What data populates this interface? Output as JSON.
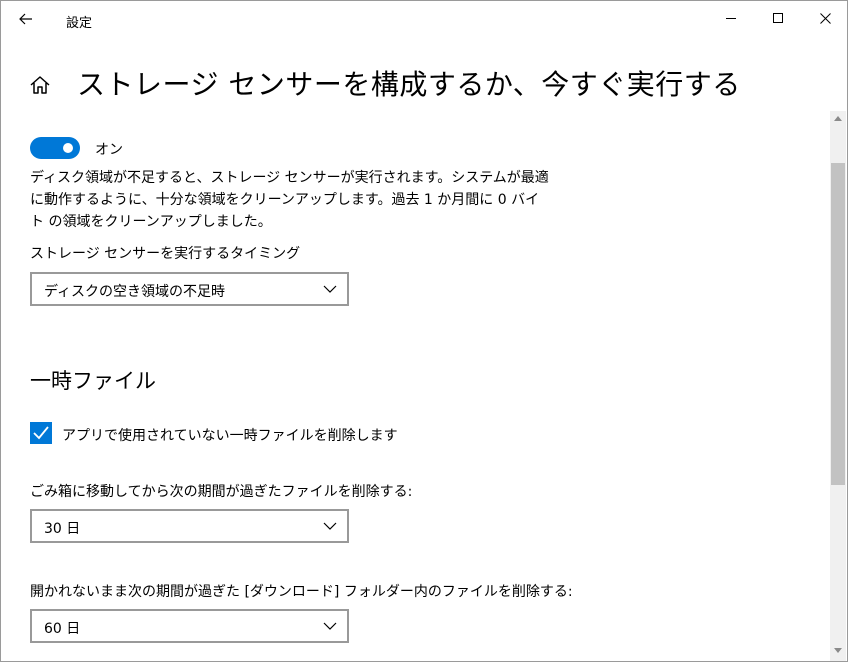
{
  "window": {
    "app_title": "設定",
    "back_icon": "back-arrow-icon",
    "minimize_icon": "minimize-icon",
    "maximize_icon": "maximize-icon",
    "close_icon": "close-icon"
  },
  "header": {
    "home_icon": "home-icon",
    "title": "ストレージ センサーを構成するか、今すぐ実行する"
  },
  "storage_sense": {
    "toggle_state": "on",
    "toggle_label": "オン",
    "description": "ディスク領域が不足すると、ストレージ センサーが実行されます。システムが最適に動作するように、十分な領域をクリーンアップします。過去 1 か月間に 0 バイト の領域をクリーンアップしました。",
    "timing_label": "ストレージ センサーを実行するタイミング",
    "timing_value": "ディスクの空き領域の不足時"
  },
  "temp_files": {
    "section_title": "一時ファイル",
    "delete_temp_checked": true,
    "delete_temp_label": "アプリで使用されていない一時ファイルを削除します",
    "recycle_label": "ごみ箱に移動してから次の期間が過ぎたファイルを削除する:",
    "recycle_value": "30 日",
    "downloads_label": "開かれないまま次の期間が過ぎた [ダウンロード] フォルダー内のファイルを削除する:",
    "downloads_value": "60 日"
  },
  "colors": {
    "accent": "#0078d7",
    "scroll_thumb": "#c2c2c2",
    "dropdown_border": "#999999"
  }
}
